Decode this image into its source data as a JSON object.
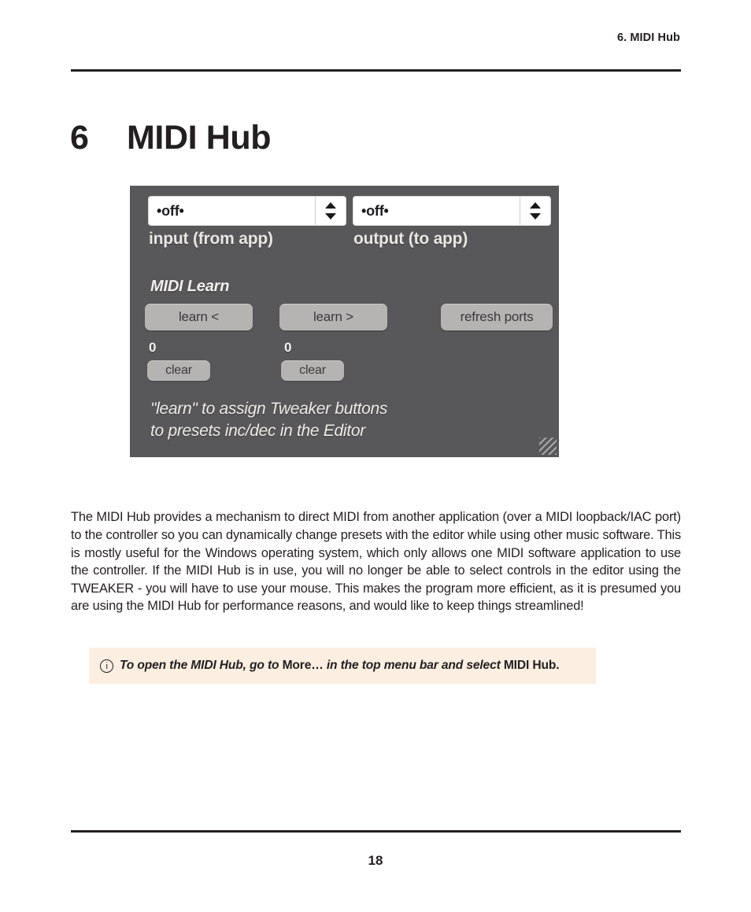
{
  "header": {
    "running_head": "6. MIDI Hub"
  },
  "title": {
    "number": "6",
    "text": "MIDI Hub"
  },
  "app_panel": {
    "input": {
      "value": "•off•",
      "label": "input (from app)"
    },
    "output": {
      "value": "•off•",
      "label": "output (to app)"
    },
    "learn_heading": "MIDI Learn",
    "learn_left_button": "learn <",
    "learn_right_button": "learn >",
    "refresh_button": "refresh ports",
    "count_left": "0",
    "count_right": "0",
    "clear_left_button": "clear",
    "clear_right_button": "clear",
    "hint_line_1": "\"learn\" to assign Tweaker buttons",
    "hint_line_2": "to  presets  inc/dec in the Editor",
    "panel_color": "#58585a",
    "button_color": "#b6b4b2"
  },
  "body": {
    "paragraph": "The MIDI Hub provides a mechanism to direct MIDI from another application (over a MIDI loopback/IAC port) to the controller so you can dynamically change presets with the editor while using other music software. This is mostly useful for the Windows operating system, which only allows one MIDI software application to use the controller. If the MIDI Hub is in use, you will no longer be able to select controls in the editor using the TWEAKER - you will have to use your mouse. This makes the program more efficient, as it is presumed you are using the MIDI Hub for performance reasons, and would like to keep things streamlined!"
  },
  "callout": {
    "icon": "info-circle-icon",
    "text_part_1": "To open the MIDI Hub, go to ",
    "text_bold_1": "More…",
    "text_part_2": " in the top menu bar and select ",
    "text_bold_2": "MIDI Hub",
    "text_part_3": ".",
    "background_color": "#fcefe2"
  },
  "footer": {
    "page_number": "18"
  }
}
